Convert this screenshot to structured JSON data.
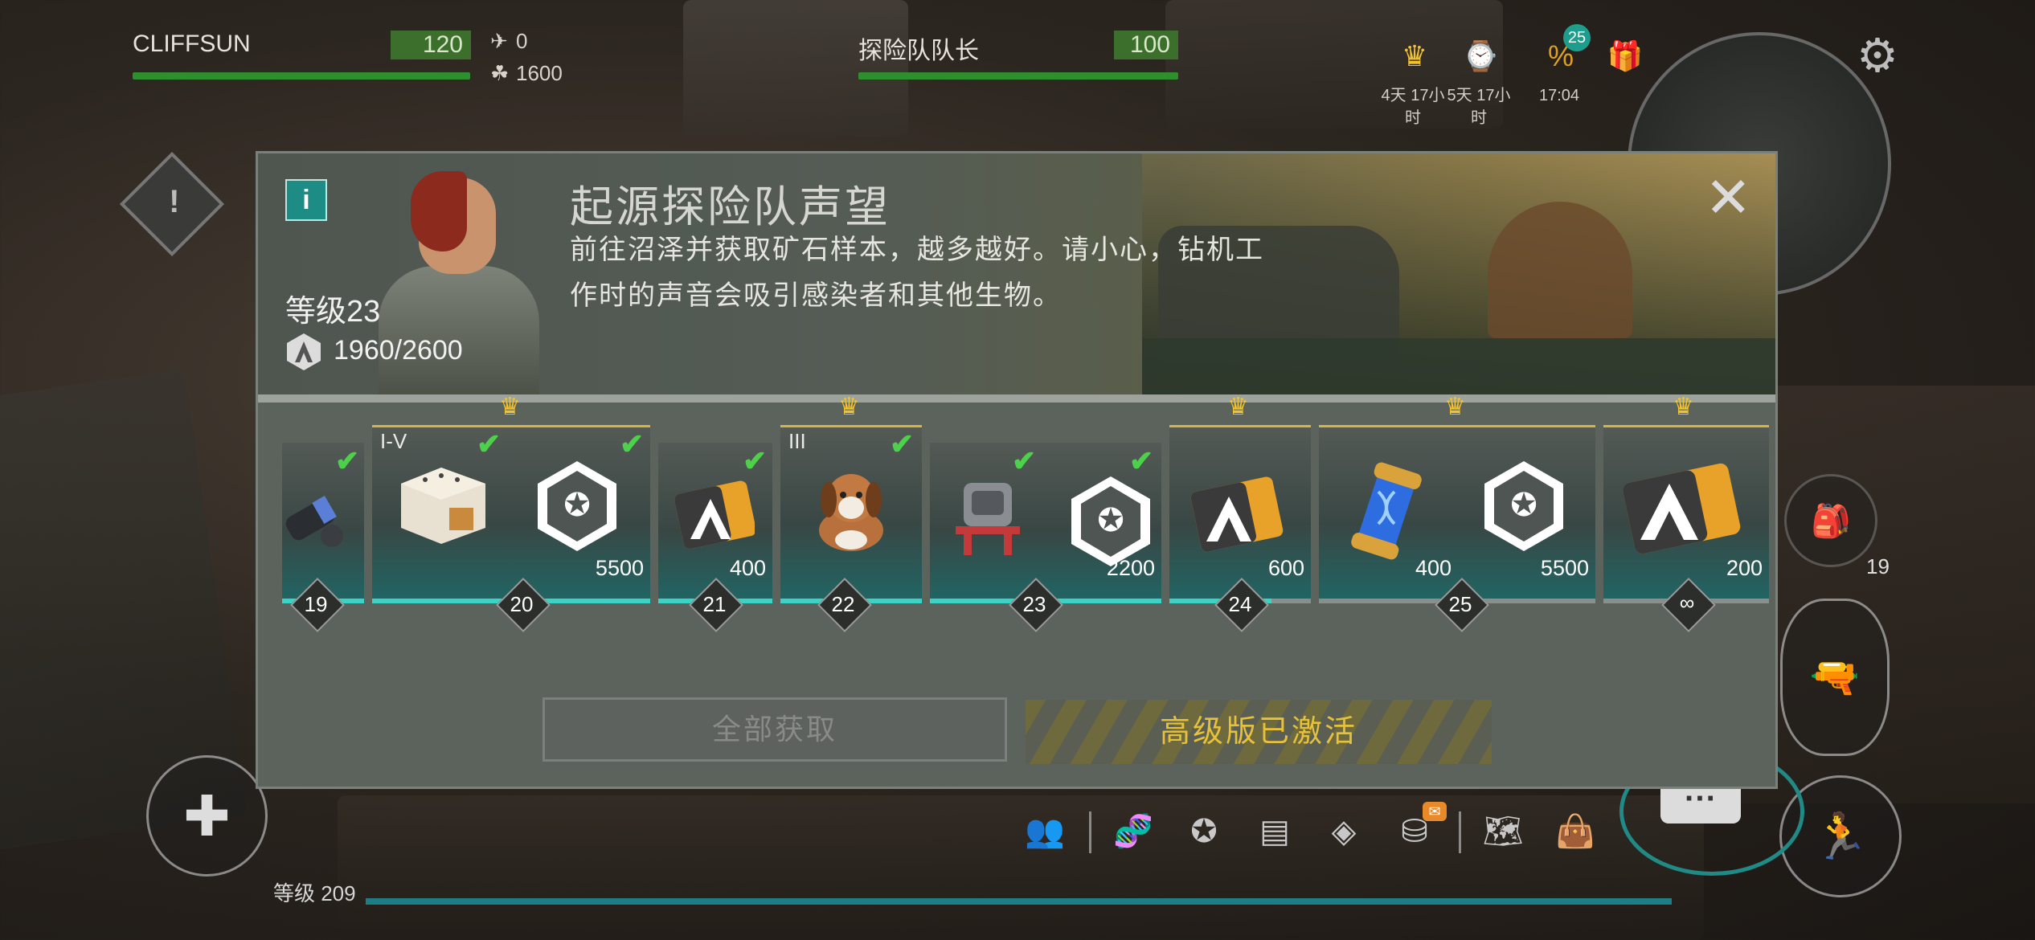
{
  "hud": {
    "player1_name": "CLIFFSUN",
    "player1_value": "120",
    "resource_small_1": "0",
    "resource_small_2": "1600",
    "player2_name": "探险队队长",
    "player2_value": "100",
    "timer1_label": "4天 17小时",
    "timer2_label": "5天 17小时",
    "timer3_label": "17:04",
    "sale_badge": "25",
    "inventory_count": "19",
    "bottom_level": "等级 209",
    "mail_badge": "✉"
  },
  "modal": {
    "info_label": "i",
    "title": "起源探险队声望",
    "description": "前往沼泽并获取矿石样本，越多越好。请小心，钻机工作时的声音会吸引感染者和其他生物。",
    "level_label": "等级23",
    "xp_text": "1960/2600",
    "close_label": "✕",
    "collect_all_label": "全部获取",
    "premium_label": "高级版已激活"
  },
  "rewards": [
    {
      "level": "19",
      "amount": "",
      "roman": "",
      "claimed": true
    },
    {
      "level": "20",
      "amount": "5500",
      "roman": "I-V",
      "claimed": true
    },
    {
      "level": "21",
      "amount": "400",
      "roman": "",
      "claimed": true
    },
    {
      "level": "22",
      "amount": "",
      "roman": "III",
      "claimed": true
    },
    {
      "level": "23",
      "amount": "2200",
      "roman": "",
      "claimed": true
    },
    {
      "level": "24",
      "amount": "600",
      "roman": "",
      "claimed": false
    },
    {
      "level": "25",
      "amount1": "400",
      "amount2": "5500",
      "claimed": false
    },
    {
      "level": "∞",
      "amount": "200",
      "claimed": false
    }
  ],
  "colors": {
    "accent_teal": "#3ad3c4",
    "check_green": "#4ed14a",
    "premium_gold": "#e6c23b",
    "crown_gold": "#f0c330"
  }
}
